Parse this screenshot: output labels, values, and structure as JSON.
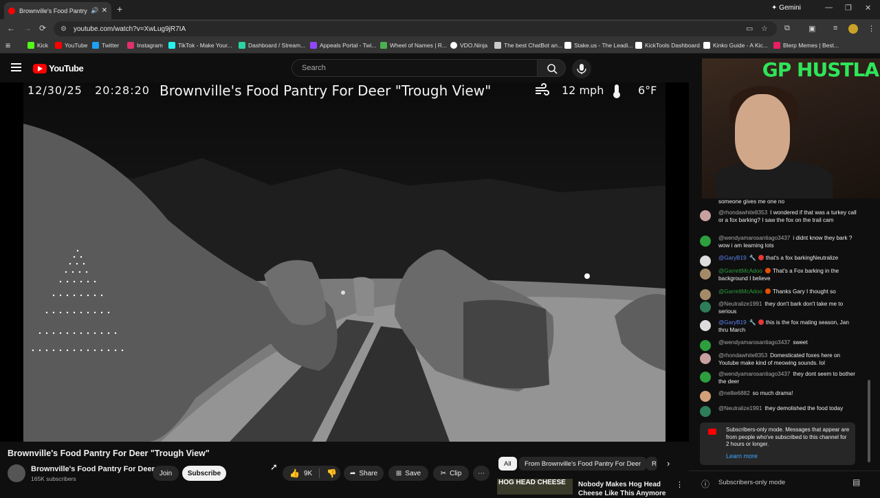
{
  "browser": {
    "tab_title": "Brownville's Food Pantry Fo",
    "gemini_label": "Gemini",
    "url": "youtube.com/watch?v=XwLug9jR7IA"
  },
  "bookmarks": [
    {
      "label": "Kick",
      "color": "#53fc18"
    },
    {
      "label": "YouTube",
      "color": "#ff0000"
    },
    {
      "label": "Twitter",
      "color": "#1da1f2"
    },
    {
      "label": "Instagram",
      "color": "#e1306c"
    },
    {
      "label": "TikTok - Make Your...",
      "color": "#25f4ee"
    },
    {
      "label": "Dashboard / Stream...",
      "color": "#2bd4a4"
    },
    {
      "label": "Appeals Portal - Twi...",
      "color": "#9146ff"
    },
    {
      "label": "Wheel of Names | R...",
      "color": "#4caf50"
    },
    {
      "label": "VDO.Ninja",
      "color": "#ffffff"
    },
    {
      "label": "The best ChatBot an...",
      "color": "#cccccc"
    },
    {
      "label": "Stake.us - The Leadi...",
      "color": "#ffffff"
    },
    {
      "label": "KickTools Dashboard",
      "color": "#ffffff"
    },
    {
      "label": "Kinko Guide - A Kic...",
      "color": "#ffffff"
    },
    {
      "label": "Blerp Memes | Best...",
      "color": "#e91e63"
    }
  ],
  "youtube": {
    "logo_text": "YouTube",
    "search_placeholder": "Search"
  },
  "overlay": {
    "date": "12/30/25",
    "time": "20:28:20",
    "title": "Brownville's Food Pantry For Deer \"Trough View\"",
    "wind": "12 mph",
    "temp": "6°F"
  },
  "video": {
    "title": "Brownville's Food Pantry For Deer \"Trough View\"",
    "channel": "Brownville's Food Pantry For Deer",
    "subscribers": "165K subscribers",
    "join": "Join",
    "subscribe": "Subscribe",
    "likes": "9K",
    "share": "Share",
    "save": "Save",
    "clip": "Clip"
  },
  "chips": [
    "All",
    "From Brownville's Food Pantry For Deer",
    "R"
  ],
  "recommended": {
    "thumb_text": "HOG HEAD CHEESE",
    "title": "Nobody Makes Hog Head Cheese Like This Anymore"
  },
  "webcam": {
    "brand": "GP HUSTLA"
  },
  "chat": {
    "messages": [
      {
        "author": "",
        "text": "someone gives me one no",
        "color": "#888888",
        "mod": false,
        "badge": false
      },
      {
        "author": "@rhondawhite8353",
        "text": "I wondered if that was a turkey call or a fox barking? I saw the fox on the trail cam",
        "color": "#c9a0a0",
        "mod": false,
        "badge": false
      },
      {
        "author": "@wendyamarosantiago3437",
        "text": "i didnt know they bark ? wow i am learning lots",
        "color": "#2e9e3e",
        "mod": false,
        "badge": false
      },
      {
        "author": "@GaryB19",
        "text": "that's a fox barkingNeutralize",
        "color": "#dddddd",
        "mod": true,
        "badge": true
      },
      {
        "author": "@GarrettMcAdoo",
        "text": "That's a Fox barking in the background I believe",
        "color": "#a58a6a",
        "mod": false,
        "badge": true
      },
      {
        "author": "@GarrettMcAdoo",
        "text": "Thanks Gary I thought so",
        "color": "#a58a6a",
        "mod": false,
        "badge": true
      },
      {
        "author": "@Neutralize1991",
        "text": "they don't bark don't take me to serious",
        "color": "#2e7d5a",
        "mod": false,
        "badge": false
      },
      {
        "author": "@GaryB19",
        "text": "this is the fox mating season, Jan thru March",
        "color": "#dddddd",
        "mod": true,
        "badge": true
      },
      {
        "author": "@wendyamarosantiago3437",
        "text": "sweet",
        "color": "#2e9e3e",
        "mod": false,
        "badge": false
      },
      {
        "author": "@rhondawhite8353",
        "text": "Domesticated foxes here on Youtube make kind of meowing sounds. lol",
        "color": "#c9a0a0",
        "mod": false,
        "badge": false
      },
      {
        "author": "@wendyamarosantiago3437",
        "text": "they dont seem to bother the deer",
        "color": "#2e9e3e",
        "mod": false,
        "badge": false
      },
      {
        "author": "@nellie6882",
        "text": "so much drama!",
        "color": "#d4a07a",
        "mod": false,
        "badge": false
      },
      {
        "author": "@Neutralize1991",
        "text": "they demolished the food today",
        "color": "#2e7d5a",
        "mod": false,
        "badge": false
      }
    ],
    "notice": "Subscribers-only mode. Messages that appear are from people who've subscribed to this channel for 2 hours or longer.",
    "learn_more": "Learn more",
    "footer": "Subscribers-only mode"
  }
}
